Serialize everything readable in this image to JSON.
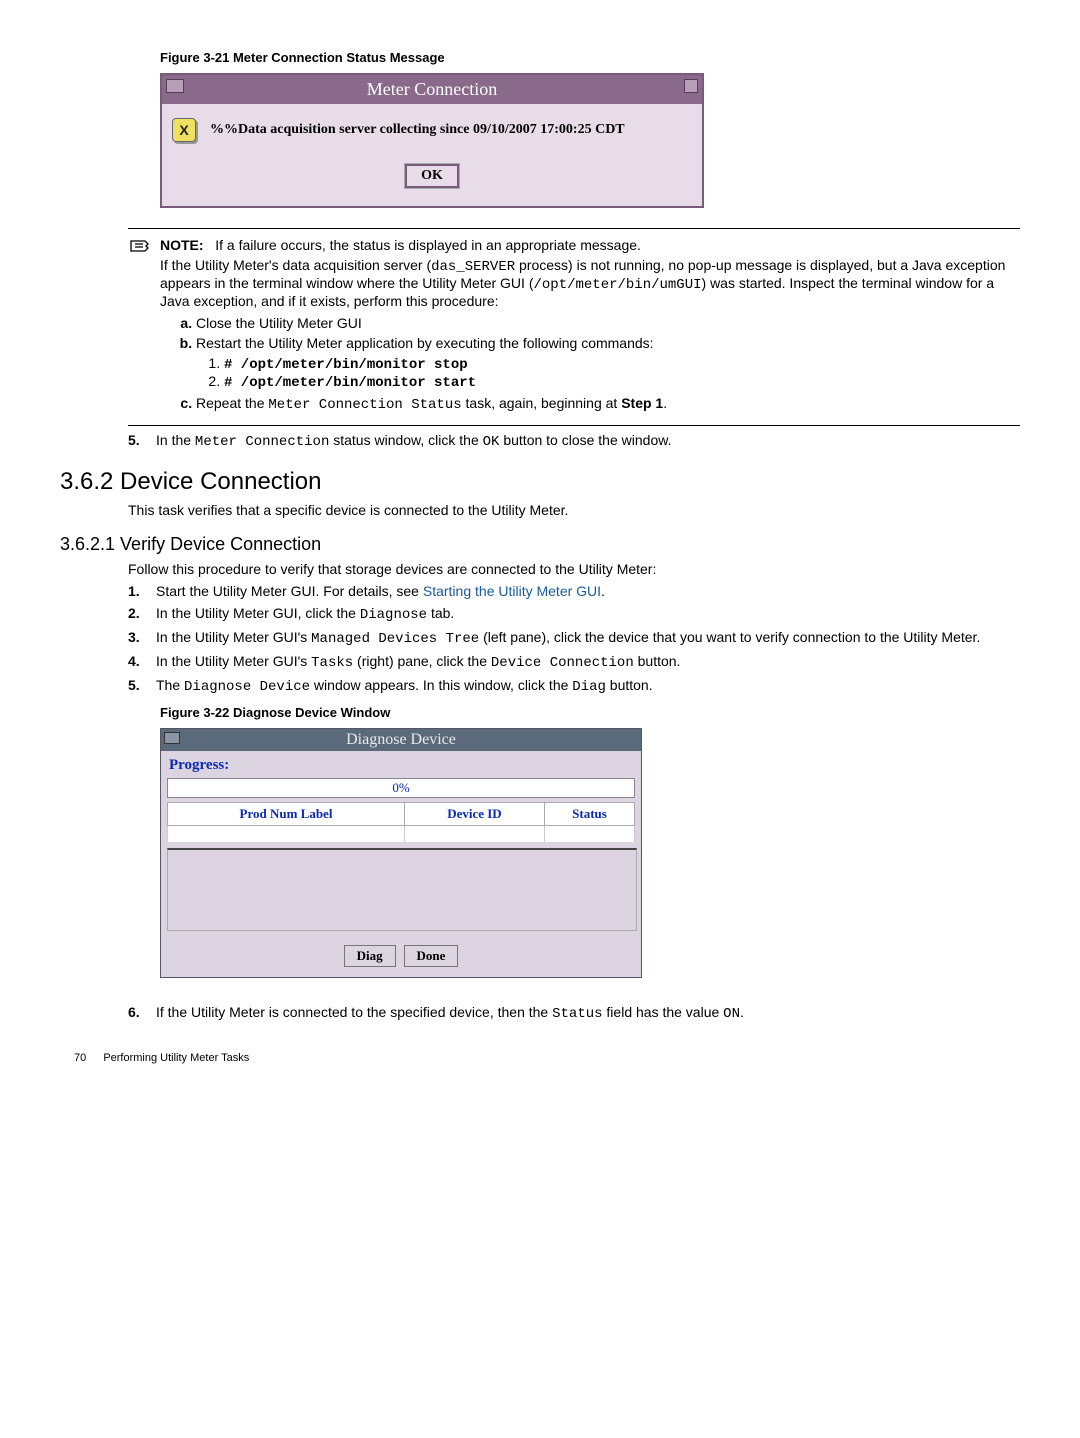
{
  "figure1": {
    "caption": "Figure 3-21 Meter Connection Status Message",
    "title": "Meter Connection",
    "message": "%%Data acquisition server collecting  since 09/10/2007 17:00:25 CDT",
    "ok": "OK"
  },
  "note": {
    "label": "NOTE:",
    "line1": "If a failure occurs, the status is displayed in an appropriate message.",
    "para_pre": "If the Utility Meter's data acquisition server (",
    "code1": "das_SERVER",
    "para_mid1": " process) is not running, no pop-up message is displayed, but a Java exception appears in the terminal window where the Utility Meter GUI (",
    "code2": "/opt/meter/bin/umGUI",
    "para_mid2": ") was started. Inspect the terminal window for a Java exception, and if it exists, perform this procedure:",
    "a": "Close the Utility Meter GUI",
    "b": "Restart the Utility Meter application by executing the following commands:",
    "cmd1": "# /opt/meter/bin/monitor stop",
    "cmd2": "# /opt/meter/bin/monitor start",
    "c_pre": "Repeat the ",
    "c_code": "Meter Connection Status",
    "c_mid": " task, again, beginning at ",
    "c_bold": "Step 1",
    "c_post": "."
  },
  "step5": {
    "num": "5.",
    "pre": "In the ",
    "code": "Meter Connection",
    "mid": " status window, click the ",
    "code2": "OK",
    "post": " button to close the window."
  },
  "sec362": {
    "heading": "3.6.2 Device Connection",
    "intro": "This task verifies that a specific device is connected to the Utility Meter."
  },
  "sec3621": {
    "heading": "3.6.2.1 Verify Device Connection",
    "intro": "Follow this procedure to verify that storage devices are connected to the Utility Meter:",
    "s1": {
      "num": "1.",
      "pre": "Start the Utility Meter GUI. For details, see ",
      "link": "Starting the Utility Meter GUI",
      "post": "."
    },
    "s2": {
      "num": "2.",
      "pre": "In the Utility Meter GUI, click the ",
      "code": "Diagnose",
      "post": " tab."
    },
    "s3": {
      "num": "3.",
      "pre": "In the Utility Meter GUI's ",
      "code": "Managed Devices Tree",
      "post": " (left pane), click the device that you want to verify connection to the Utility Meter."
    },
    "s4": {
      "num": "4.",
      "pre": "In the Utility Meter GUI's ",
      "code": "Tasks",
      "mid": " (right) pane, click the ",
      "code2": "Device Connection",
      "post": " button."
    },
    "s5": {
      "num": "5.",
      "pre": "The ",
      "code": "Diagnose Device",
      "mid": " window appears. In this window, click the ",
      "code2": "Diag",
      "post": " button."
    }
  },
  "figure2": {
    "caption": "Figure 3-22 Diagnose Device Window",
    "title": "Diagnose Device",
    "progress_label": "Progress:",
    "progress_value": "0%",
    "col1": "Prod Num Label",
    "col2": "Device ID",
    "col3": "Status",
    "btn_diag": "Diag",
    "btn_done": "Done"
  },
  "step6": {
    "num": "6.",
    "pre": "If the Utility Meter is connected to the specified device, then the ",
    "code1": "Status",
    "mid": " field has the value ",
    "code2": "ON",
    "post": "."
  },
  "footer": {
    "page": "70",
    "text": "Performing Utility Meter Tasks"
  }
}
